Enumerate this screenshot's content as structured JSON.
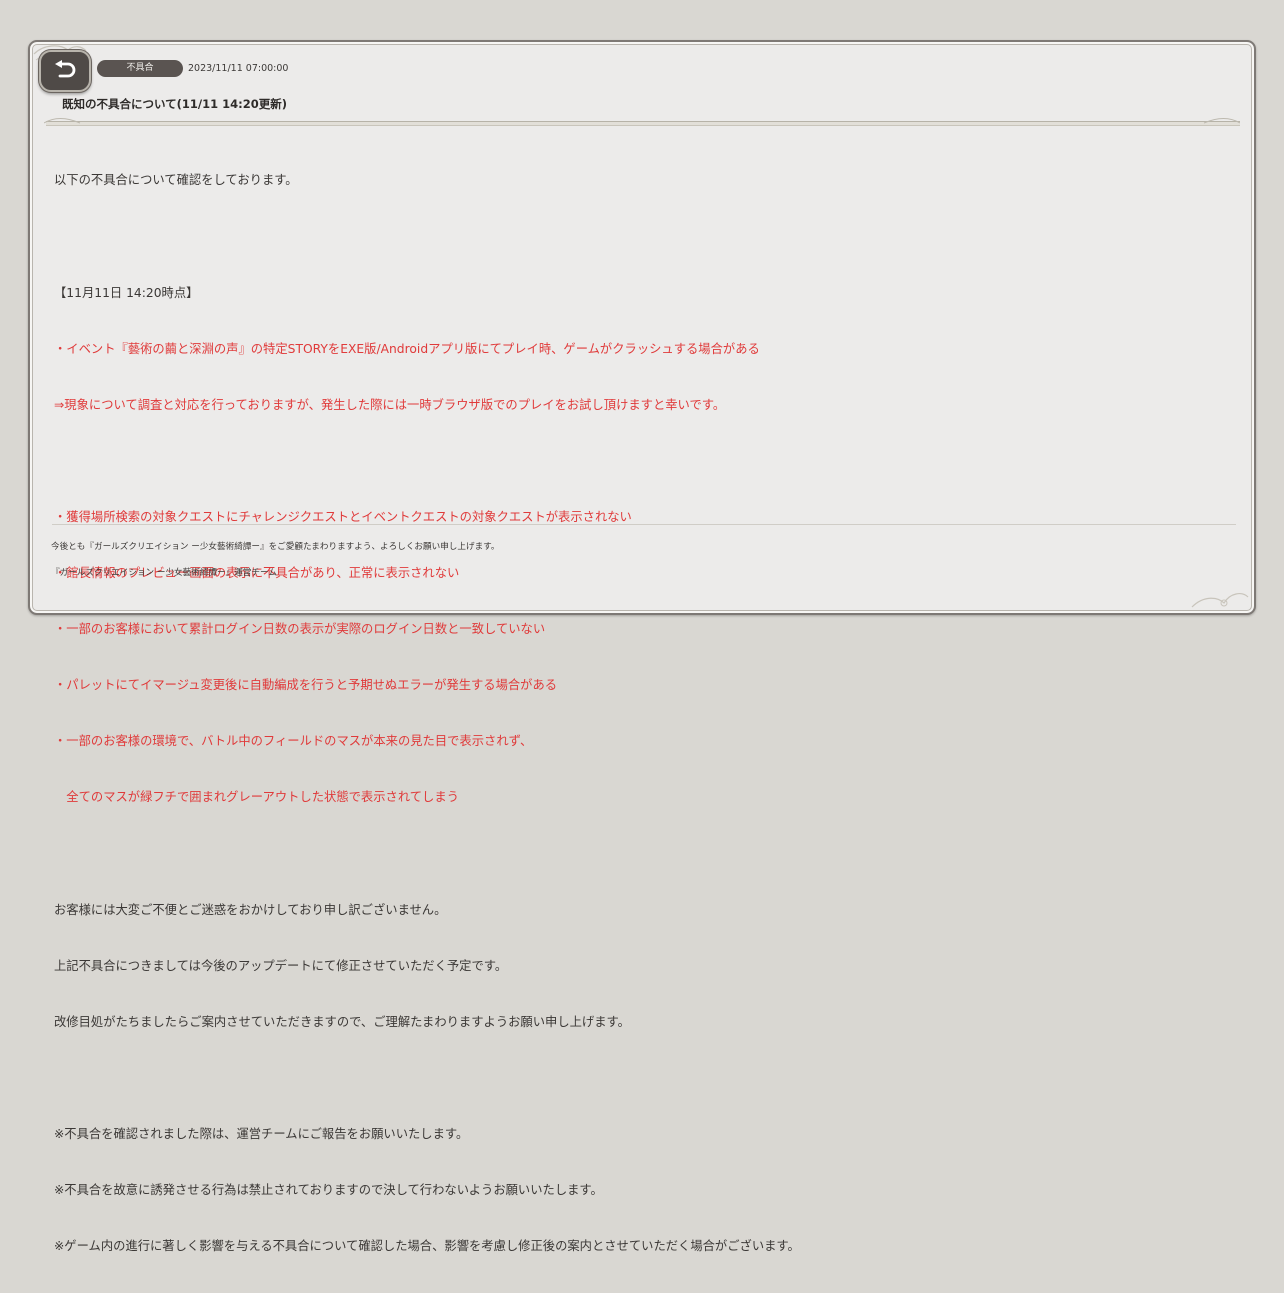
{
  "header": {
    "back_icon": "back-arrow-icon",
    "category": "不具合",
    "date": "2023/11/11 07:00:00",
    "title": "既知の不具合について(11/11 14:20更新)"
  },
  "body": {
    "intro": "以下の不具合について確認をしております。",
    "update_heading": "【11月11日 14:20時点】",
    "red_lines": [
      "・イベント『藝術の繭と深淵の声』の特定STORYをEXE版/Androidアプリ版にてプレイ時、ゲームがクラッシュする場合がある",
      "⇒現象について調査と対応を行っておりますが、発生した際には一時ブラウザ版でのプレイをお試し頂けますと幸いです。",
      "・獲得場所検索の対象クエストにチャレンジクエストとイベントクエストの対象クエストが表示されない",
      "・館長情報のプレビュー画面の表示に不具合があり、正常に表示されない",
      "・一部のお客様において累計ログイン日数の表示が実際のログイン日数と一致していない",
      "・パレットにてイマージュ変更後に自動編成を行うと予期せぬエラーが発生する場合がある",
      "・一部のお客様の環境で、バトル中のフィールドのマスが本来の見た目で表示されず、",
      "　全てのマスが緑フチで囲まれグレーアウトした状態で表示されてしまう"
    ],
    "apology_lines": [
      "お客様には大変ご不便とご迷惑をおかけしており申し訳ございません。",
      "上記不具合につきましては今後のアップデートにて修正させていただく予定です。",
      "改修目処がたちましたらご案内させていただきますので、ご理解たまわりますようお願い申し上げます。"
    ],
    "notes": [
      "※不具合を確認されました際は、運営チームにご報告をお願いいたします。",
      "※不具合を故意に誘発させる行為は禁止されておりますので決して行わないようお願いいたします。",
      "※ゲーム内の進行に著しく影響を与える不具合について確認した場合、影響を考慮し修正後の案内とさせていただく場合がございます。"
    ]
  },
  "footer": {
    "message": "今後とも『ガールズクリエイション ー少女藝術綺譚ー』をご愛顧たまわりますよう、よろしくお願い申し上げます。",
    "signature": "『ガールズクリエイション ー少女藝術綺譚ー』運営チーム"
  },
  "colors": {
    "alert_text": "#e03a3a",
    "body_text": "#3b3836",
    "panel_bg": "#ecebea",
    "badge_bg": "#5a5451"
  }
}
